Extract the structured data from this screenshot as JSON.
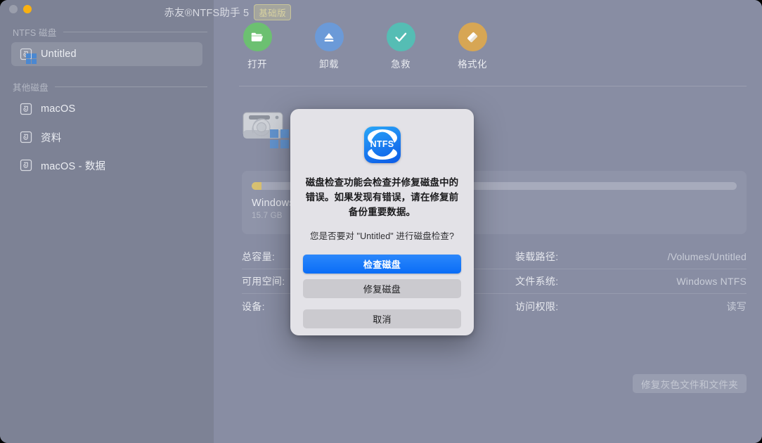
{
  "window": {
    "title": "赤友®NTFS助手 5",
    "edition_badge": "基础版",
    "traffic": {
      "close": "close-button",
      "minimize": "minimize-button"
    }
  },
  "sidebar": {
    "groups": [
      {
        "label": "NTFS 磁盘",
        "items": [
          {
            "label": "Untitled",
            "icon": "disk-windows-icon",
            "selected": true
          }
        ]
      },
      {
        "label": "其他磁盘",
        "items": [
          {
            "label": "macOS",
            "icon": "disk-icon",
            "selected": false
          },
          {
            "label": "资料",
            "icon": "disk-icon",
            "selected": false
          },
          {
            "label": "macOS - 数据",
            "icon": "disk-icon",
            "selected": false
          }
        ]
      }
    ]
  },
  "toolbar": {
    "buttons": [
      {
        "label": "打开",
        "icon": "folder-open-icon",
        "color": "#6cc071"
      },
      {
        "label": "卸载",
        "icon": "eject-icon",
        "color": "#6b9ad8"
      },
      {
        "label": "急救",
        "icon": "check-circle-icon",
        "color": "#55bdb4"
      },
      {
        "label": "格式化",
        "icon": "eraser-icon",
        "color": "#d8a council"
      }
    ]
  },
  "volume": {
    "icon": "hard-drive-windows-icon",
    "usage_percent": 2,
    "usage_fill_color": "#d8c070",
    "name": "Windows",
    "size": "15.7 GB"
  },
  "info": {
    "rows": [
      {
        "left_key": "总容量:",
        "left_value": "",
        "right_key": "装载路径:",
        "right_value": "/Volumes/Untitled"
      },
      {
        "left_key": "可用空间:",
        "left_value": "",
        "right_key": "文件系统:",
        "right_value": "Windows NTFS"
      },
      {
        "left_key": "设备:",
        "left_value": "",
        "right_key": "访问权限:",
        "right_value": "读写"
      }
    ]
  },
  "footer": {
    "fix_gray_files_label": "修复灰色文件和文件夹"
  },
  "modal": {
    "logo_text": "NTFS",
    "title": "磁盘检查功能会检查并修复磁盘中的错误。如果发现有错误，请在修复前备份重要数据。",
    "subtitle": "您是否要对 \"Untitled\" 进行磁盘检查?",
    "buttons": {
      "primary": "检查磁盘",
      "secondary": "修复磁盘",
      "cancel": "取消"
    },
    "accent_color": "#0a6df7"
  }
}
